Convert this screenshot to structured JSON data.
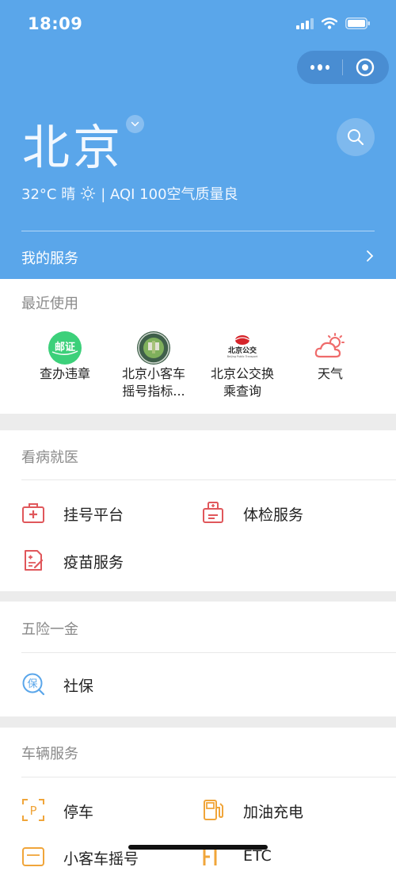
{
  "status_bar": {
    "time": "18:09"
  },
  "header": {
    "city": "北京",
    "weather_temp": "32°C 晴",
    "weather_aqi": "| AQI 100空气质量良",
    "my_services_label": "我的服务"
  },
  "recent": {
    "title": "最近使用",
    "items": [
      {
        "label_line1": "查办违章",
        "label_line2": "",
        "icon": "traffic-violation-icon",
        "icon_text": "邮证"
      },
      {
        "label_line1": "北京小客车",
        "label_line2": "摇号指标...",
        "icon": "car-lottery-seal-icon"
      },
      {
        "label_line1": "北京公交换",
        "label_line2": "乘查询",
        "icon": "beijing-bus-icon",
        "icon_text": "北京公交",
        "icon_subtext": "Beijing Public Transport"
      },
      {
        "label_line1": "天气",
        "label_line2": "",
        "icon": "weather-cloud-sun-icon"
      }
    ]
  },
  "medical": {
    "title": "看病就医",
    "items": [
      {
        "label": "挂号平台",
        "icon": "medical-kit-icon"
      },
      {
        "label": "体检服务",
        "icon": "physical-exam-icon"
      },
      {
        "label": "疫苗服务",
        "icon": "vaccine-record-icon"
      }
    ]
  },
  "insurance": {
    "title": "五险一金",
    "items": [
      {
        "label": "社保",
        "icon": "social-security-icon",
        "icon_text": "保"
      }
    ]
  },
  "vehicle": {
    "title": "车辆服务",
    "items": [
      {
        "label": "停车",
        "icon": "parking-icon",
        "icon_text": "P"
      },
      {
        "label": "加油充电",
        "icon": "fuel-pump-icon"
      },
      {
        "label": "小客车摇号",
        "icon": "car-lottery-icon"
      },
      {
        "label": "ETC",
        "icon": "etc-icon"
      }
    ]
  },
  "colors": {
    "header_blue": "#5aa6ea",
    "medical_red": "#e0575b",
    "insurance_blue": "#5aa6ea",
    "vehicle_orange": "#f0a53a",
    "section_gap": "#ececec"
  }
}
